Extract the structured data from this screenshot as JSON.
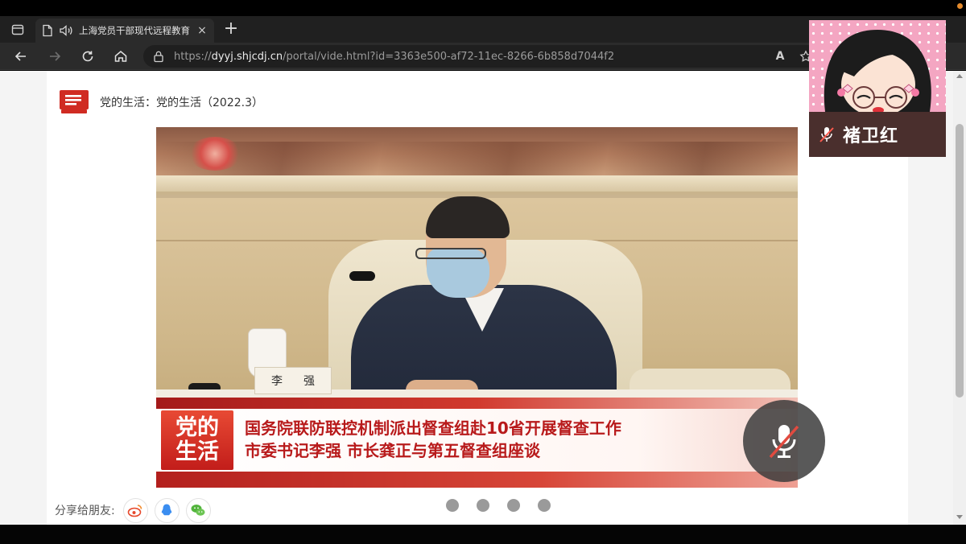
{
  "browser": {
    "tab": {
      "title": "上海党员干部现代远程教育",
      "close": "×"
    },
    "new_tab": "+",
    "url": {
      "scheme": "https://",
      "host": "dyyj.shjcdj.cn",
      "path": "/portal/vide.html?id=3363e500-af72-11ec-8266-6b858d7044f2"
    },
    "read_aloud": "A",
    "colors": {
      "tabbar": "#202020",
      "toolbar": "#2b2b2b"
    }
  },
  "page": {
    "header_title": "党的生活：党的生活（2022.3）",
    "video": {
      "nameplate": [
        "李",
        "强"
      ],
      "logo": [
        "党的",
        "生活"
      ],
      "headline_lines": [
        "国务院联防联控机制派出督查组赴10省开展督查工作",
        "市委书记李强 市长龚正与第五督查组座谈"
      ]
    },
    "share_label": "分享给朋友:",
    "share_icons": [
      "weibo-icon",
      "qq-icon",
      "wechat-icon"
    ],
    "carousel_dots": 4,
    "colors": {
      "accent": "#c8261f",
      "headline": "#b81a1b"
    }
  },
  "participant": {
    "name": "褚卫红",
    "muted": true
  }
}
